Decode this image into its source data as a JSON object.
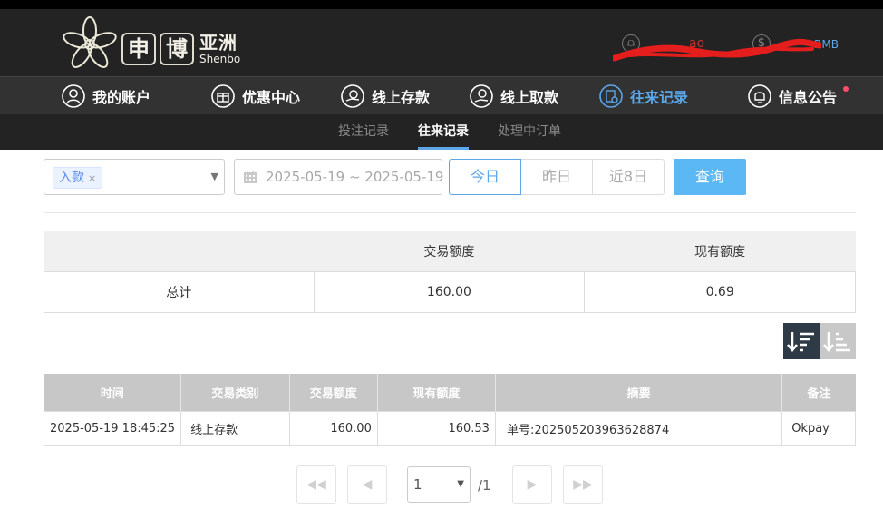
{
  "brand": {
    "char1": "申",
    "char2": "博",
    "cn": "亚洲",
    "en": "Shenbo"
  },
  "account": {
    "user_icon": "user-circle-icon",
    "balance_icon": "dollar-circle-icon",
    "balance_unit": "RMB",
    "username_visible": "ao"
  },
  "nav": [
    {
      "label": "我的账户",
      "icon": "user-icon"
    },
    {
      "label": "优惠中心",
      "icon": "gift-icon"
    },
    {
      "label": "线上存款",
      "icon": "deposit-icon"
    },
    {
      "label": "线上取款",
      "icon": "withdraw-icon"
    },
    {
      "label": "往来记录",
      "icon": "records-icon",
      "active": true
    },
    {
      "label": "信息公告",
      "icon": "bell-icon"
    }
  ],
  "subnav": [
    {
      "label": "投注记录"
    },
    {
      "label": "往来记录",
      "active": true
    },
    {
      "label": "处理中订单"
    }
  ],
  "filters": {
    "type_tag": "入款",
    "type_tag_close": "×",
    "date_range": "2025-05-19 ~ 2025-05-19",
    "quick_buttons": [
      "今日",
      "昨日",
      "近8日"
    ],
    "query_label": "查询"
  },
  "summary": {
    "headers": [
      "",
      "交易额度",
      "现有额度"
    ],
    "row": [
      "总计",
      "160.00",
      "0.69"
    ]
  },
  "table": {
    "headers": [
      "时间",
      "交易类别",
      "交易额度",
      "现有额度",
      "摘要",
      "备注"
    ],
    "rows": [
      [
        "2025-05-19 18:45:25",
        "线上存款",
        "160.00",
        "160.53",
        "单号:202505203963628874",
        "Okpay"
      ]
    ]
  },
  "pagination": {
    "current": "1",
    "total": "/1",
    "first": "◀◀",
    "prev": "◀",
    "next": "▶",
    "last": "▶▶"
  },
  "colors": {
    "accent": "#5ba7ea",
    "header_bg": "#232323",
    "nav_bg": "#323232",
    "query_btn": "#5bb8f5"
  }
}
